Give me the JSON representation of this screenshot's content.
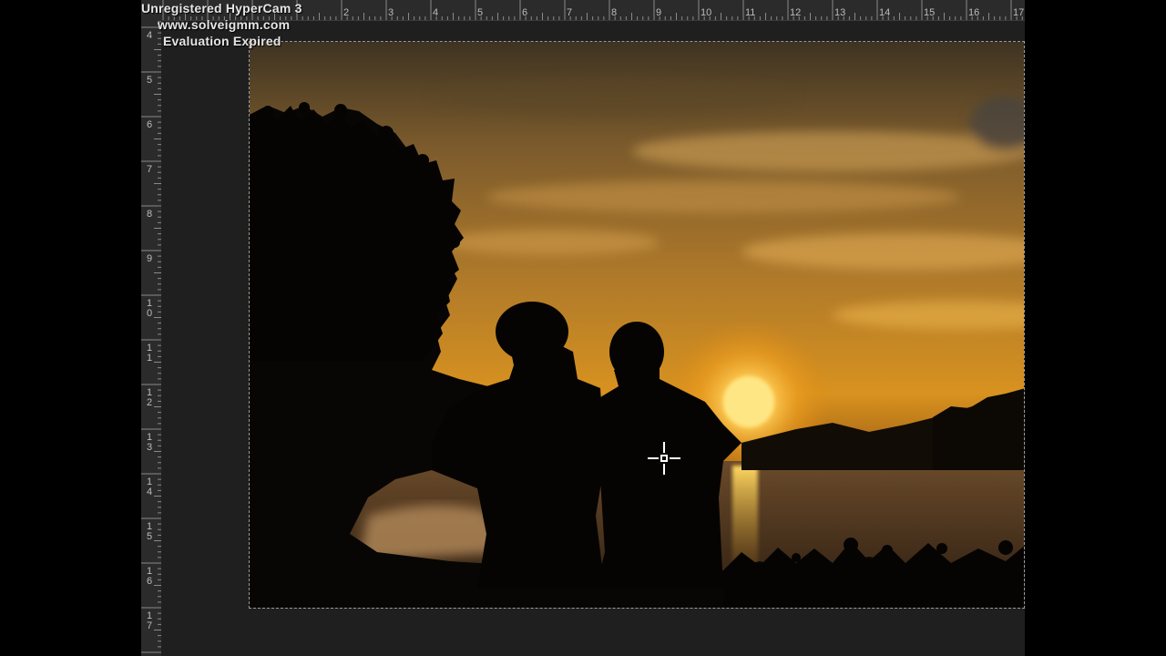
{
  "watermark": {
    "title": "Unregistered HyperCam 3",
    "url": "www.solveigmm.com",
    "status": "Evaluation Expired"
  },
  "ruler": {
    "top_labels": [
      "2",
      "3",
      "4",
      "5",
      "6",
      "7",
      "8",
      "9",
      "10",
      "11",
      "12",
      "13",
      "14",
      "15",
      "16",
      "17"
    ],
    "left_labels": [
      "4",
      "5",
      "6",
      "7",
      "8",
      "9",
      "1\n0",
      "1\n1",
      "1\n2",
      "1\n3",
      "1\n4",
      "1\n5",
      "1\n6",
      "1\n7"
    ]
  },
  "colors": {
    "background": "#1e1e1e",
    "ruler": "#2b2b2b",
    "sky_top": "#4a3a22",
    "sky_mid": "#c98a2a",
    "sun": "#ffd86a"
  },
  "canvas": {
    "image_description_icon": "sunset-silhouette-painting",
    "cursor_icon": "crosshair-cursor-icon"
  }
}
